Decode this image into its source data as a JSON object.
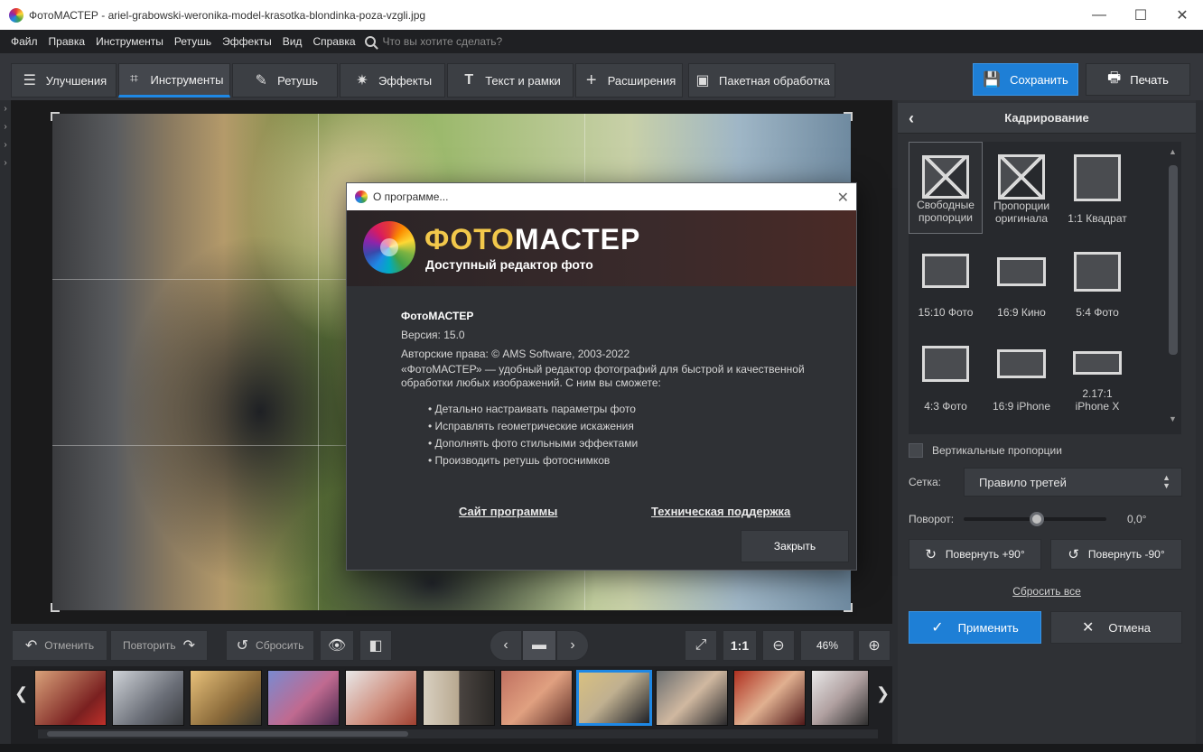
{
  "window": {
    "title": "ФотоМАСТЕР - ariel-grabowski-weronika-model-krasotka-blondinka-poza-vzgli.jpg",
    "min": "—",
    "max": "☐",
    "close": "✕"
  },
  "menu": {
    "items": [
      "Файл",
      "Правка",
      "Инструменты",
      "Ретушь",
      "Эффекты",
      "Вид",
      "Справка"
    ],
    "search_placeholder": "Что вы хотите сделать?"
  },
  "tabs": [
    {
      "label": "Улучшения",
      "icon": "sliders-icon"
    },
    {
      "label": "Инструменты",
      "icon": "crop-icon"
    },
    {
      "label": "Ретушь",
      "icon": "brush-icon"
    },
    {
      "label": "Эффекты",
      "icon": "sparkle-icon"
    },
    {
      "label": "Текст и рамки",
      "icon": "text-icon"
    },
    {
      "label": "Расширения",
      "icon": "plus-icon"
    },
    {
      "label": "Пакетная обработка",
      "icon": "images-icon"
    }
  ],
  "toolbar": {
    "save_label": "Сохранить",
    "print_label": "Печать"
  },
  "dialog": {
    "title": "О программе...",
    "brand_part1": "ФОТО",
    "brand_part2": "МАСТЕР",
    "tagline": "Доступный редактор фото",
    "product": "ФотоМАСТЕР",
    "version": "Версия: 15.0",
    "copyright": "Авторские права: © AMS Software, 2003-2022",
    "description": "«ФотоМАСТЕР» — удобный редактор фотографий для быстрой и качественной обработки любых изображений. С ним вы сможете:",
    "bullets": [
      "Детально настраивать параметры фото",
      "Исправлять геометрические искажения",
      "Дополнять фото стильными эффектами",
      "Производить ретушь фотоснимков"
    ],
    "link_site": "Сайт программы",
    "link_support": "Техническая поддержка",
    "close_label": "Закрыть"
  },
  "controls": {
    "undo": "Отменить",
    "redo": "Повторить",
    "reset": "Сбросить",
    "ratio": "1:1",
    "zoom": "46%"
  },
  "panel": {
    "title": "Кадрирование",
    "presets": [
      {
        "label": "Свободные пропорции"
      },
      {
        "label": "Пропорции оригинала"
      },
      {
        "label": "1:1 Квадрат"
      },
      {
        "label": "15:10 Фото"
      },
      {
        "label": "16:9 Кино"
      },
      {
        "label": "5:4 Фото"
      },
      {
        "label": "4:3 Фото"
      },
      {
        "label": "16:9 iPhone"
      },
      {
        "label": "2.17:1 iPhone X"
      }
    ],
    "vertical_label": "Вертикальные пропорции",
    "grid_label": "Сетка:",
    "grid_value": "Правило третей",
    "rotation_label": "Поворот:",
    "rotation_value": "0,0°",
    "rotate_plus": "Повернуть +90°",
    "rotate_minus": "Повернуть -90°",
    "reset_all": "Сбросить все",
    "apply": "Применить",
    "cancel": "Отмена"
  },
  "colors": {
    "accent": "#1e7fd6",
    "brand_gold": "#f2c84b"
  }
}
